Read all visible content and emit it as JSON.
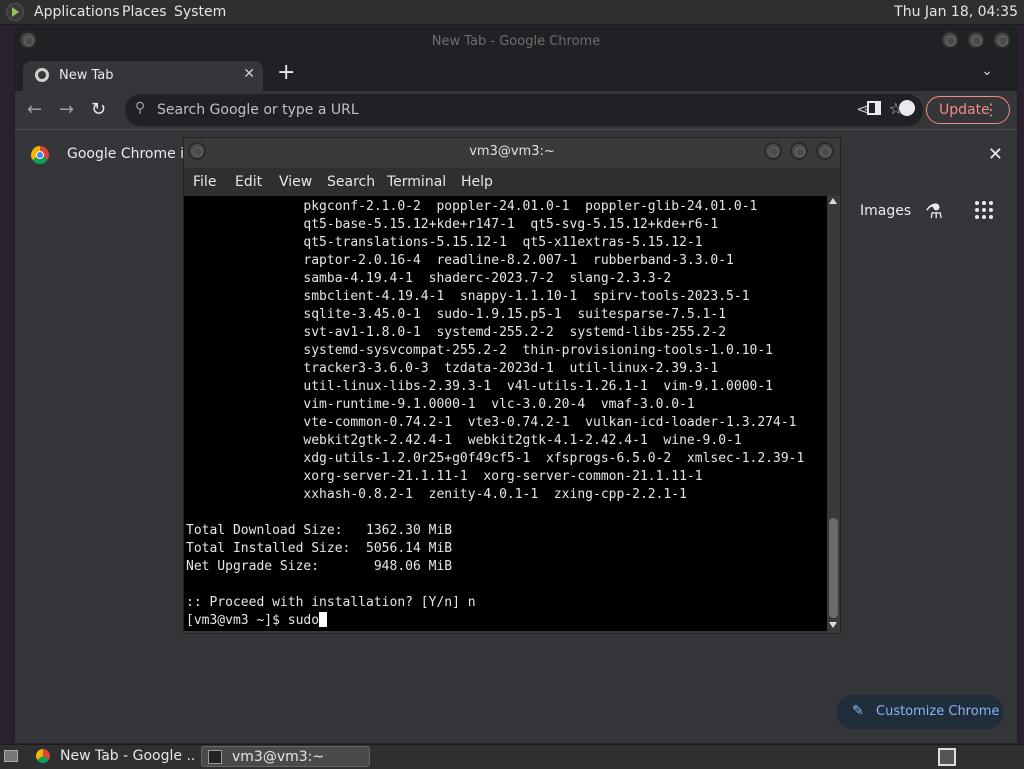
{
  "top_panel": {
    "menus": [
      "Applications",
      "Places",
      "System"
    ],
    "clock": "Thu Jan 18, 04:35"
  },
  "chrome": {
    "window_title": "New Tab - Google Chrome",
    "tab_title": "New Tab",
    "tab_close": "✕",
    "new_tab": "+",
    "tab_search": "⌄",
    "back": "←",
    "forward": "→",
    "reload": "↻",
    "omnibox_placeholder": "Search Google or type a URL",
    "update_label": "Update",
    "menu_dots": "⋮",
    "infobar_text": "Google Chrome isn",
    "infobar_close": "✕",
    "images_link": "Images",
    "customize_label": "Customize Chrome"
  },
  "terminal": {
    "window_title": "vm3@vm3:~",
    "menus": [
      "File",
      "Edit",
      "View",
      "Search",
      "Terminal",
      "Help"
    ],
    "output": "               pkgconf-2.1.0-2  poppler-24.01.0-1  poppler-glib-24.01.0-1\n               qt5-base-5.15.12+kde+r147-1  qt5-svg-5.15.12+kde+r6-1\n               qt5-translations-5.15.12-1  qt5-x11extras-5.15.12-1\n               raptor-2.0.16-4  readline-8.2.007-1  rubberband-3.3.0-1\n               samba-4.19.4-1  shaderc-2023.7-2  slang-2.3.3-2\n               smbclient-4.19.4-1  snappy-1.1.10-1  spirv-tools-2023.5-1\n               sqlite-3.45.0-1  sudo-1.9.15.p5-1  suitesparse-7.5.1-1\n               svt-av1-1.8.0-1  systemd-255.2-2  systemd-libs-255.2-2\n               systemd-sysvcompat-255.2-2  thin-provisioning-tools-1.0.10-1\n               tracker3-3.6.0-3  tzdata-2023d-1  util-linux-2.39.3-1\n               util-linux-libs-2.39.3-1  v4l-utils-1.26.1-1  vim-9.1.0000-1\n               vim-runtime-9.1.0000-1  vlc-3.0.20-4  vmaf-3.0.0-1\n               vte-common-0.74.2-1  vte3-0.74.2-1  vulkan-icd-loader-1.3.274-1\n               webkit2gtk-2.42.4-1  webkit2gtk-4.1-2.42.4-1  wine-9.0-1\n               xdg-utils-1.2.0r25+g0f49cf5-1  xfsprogs-6.5.0-2  xmlsec-1.2.39-1\n               xorg-server-21.1.11-1  xorg-server-common-21.1.11-1\n               xxhash-0.8.2-1  zenity-4.0.1-1  zxing-cpp-2.2.1-1\n\nTotal Download Size:   1362.30 MiB\nTotal Installed Size:  5056.14 MiB\nNet Upgrade Size:       948.06 MiB\n\n:: Proceed with installation? [Y/n] n",
    "prompt": "[vm3@vm3 ~]$ sudo"
  },
  "taskbar": {
    "chrome_task": "New Tab - Google ...",
    "terminal_task": "vm3@vm3:~"
  }
}
